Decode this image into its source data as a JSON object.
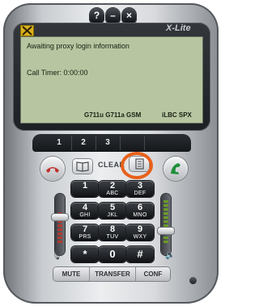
{
  "window": {
    "help_label": "?",
    "minimize_label": "–",
    "close_label": "×",
    "brand": "X-Lite"
  },
  "display": {
    "status": "Awaiting proxy login information",
    "call_timer": "Call Timer: 0:00:00",
    "codecs": "G711u G711a GSM",
    "codecs_right": "iLBC SPX"
  },
  "lines": [
    "1",
    "2",
    "3"
  ],
  "controls": {
    "clear_label": "CLEAR"
  },
  "keypad": [
    {
      "digit": "1",
      "letters": ""
    },
    {
      "digit": "2",
      "letters": "ABC"
    },
    {
      "digit": "3",
      "letters": "DEF"
    },
    {
      "digit": "4",
      "letters": "GHI"
    },
    {
      "digit": "5",
      "letters": "JKL"
    },
    {
      "digit": "6",
      "letters": "MNO"
    },
    {
      "digit": "7",
      "letters": "PRS"
    },
    {
      "digit": "8",
      "letters": "TUV"
    },
    {
      "digit": "9",
      "letters": "WXY"
    },
    {
      "digit": "*",
      "letters": ""
    },
    {
      "digit": "0",
      "letters": ""
    },
    {
      "digit": "#",
      "letters": ""
    }
  ],
  "bottom": {
    "mute_label": "MUTE",
    "transfer_label": "TRANSFER",
    "conf_label": "CONF"
  },
  "colors": {
    "lcd_background": "#b7c6a1",
    "highlight_ring": "#e8601a",
    "hangup_red": "#c0302a",
    "call_green": "#1f8f3a"
  }
}
